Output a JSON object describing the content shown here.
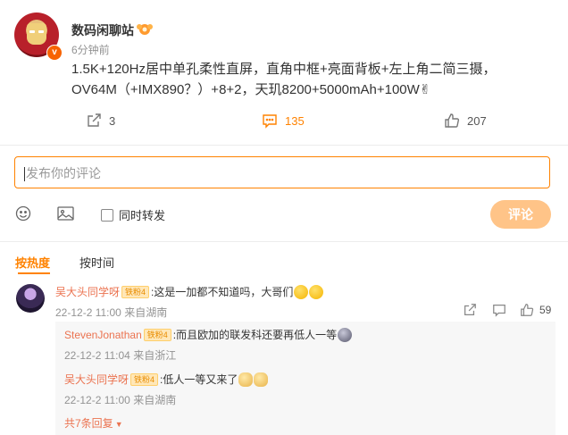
{
  "post": {
    "author": "数码闲聊站",
    "author_badge_icon": "honor-badge-icon",
    "time": "6分钟前",
    "text": "1.5K+120Hz居中单孔柔性直屏，直角中框+亮面背板+左上角二简三摄，OV64M（+IMX890？）+8+2，天玑8200+5000mAh+100W✌",
    "verified_mark": "v",
    "actions": {
      "repost_count": "3",
      "comment_count": "135",
      "like_count": "207"
    }
  },
  "comment_form": {
    "placeholder": "发布你的评论",
    "also_repost_label": "同时转发",
    "submit_label": "评论"
  },
  "sort": {
    "hot_label": "按热度",
    "time_label": "按时间"
  },
  "comments": [
    {
      "user": "吴大头同学呀",
      "fan_badge": "铁粉4",
      "text": ":这是一加都不知道吗，大哥们",
      "time": "22-12-2 11:00",
      "location": "来自湖南",
      "like_count": "59"
    }
  ],
  "replies": [
    {
      "user": "StevenJonathan",
      "fan_badge": "铁粉4",
      "text": ":而且欧加的联发科还要再低人一等",
      "time": "22-12-2 11:04",
      "location": "来自浙江"
    },
    {
      "user": "吴大头同学呀",
      "fan_badge": "铁粉4",
      "text": ":低人一等又来了",
      "time": "22-12-2 11:00",
      "location": "来自湖南"
    }
  ],
  "more_replies": "共7条回复",
  "colors": {
    "accent": "#ff8200",
    "username": "#eb7350",
    "submit_disabled": "#ffc488",
    "meta_gray": "#939393"
  }
}
